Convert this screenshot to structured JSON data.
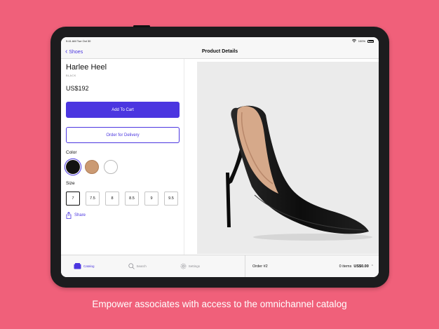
{
  "status_bar": {
    "time": "9:41 AM",
    "date": "Tue Oct 30",
    "battery": "100%"
  },
  "nav": {
    "back_label": "Shoes",
    "title": "Product Details"
  },
  "product": {
    "name": "Harlee Heel",
    "variant": "BLACK",
    "price": "US$192",
    "add_to_cart_label": "Add To Cart",
    "delivery_label": "Order for Delivery",
    "color_label": "Color",
    "colors": [
      "#121212",
      "#cb9a73",
      "#ffffff"
    ],
    "selected_color_index": 0,
    "size_label": "Size",
    "sizes": [
      "7",
      "7.5",
      "8",
      "8.5",
      "9",
      "9.5"
    ],
    "selected_size": "7",
    "share_label": "Share"
  },
  "tabbar": {
    "tabs": [
      {
        "label": "Catalog",
        "icon": "catalog-icon",
        "active": true
      },
      {
        "label": "Search",
        "icon": "search-icon",
        "active": false
      },
      {
        "label": "Settings",
        "icon": "gear-icon",
        "active": false
      }
    ],
    "order": {
      "label": "Order #2",
      "items": "0 items",
      "total": "US$0.00"
    }
  },
  "caption": "Empower associates with access to the omnichannel catalog",
  "colors": {
    "background": "#f0607a",
    "accent": "#4b36e0"
  }
}
